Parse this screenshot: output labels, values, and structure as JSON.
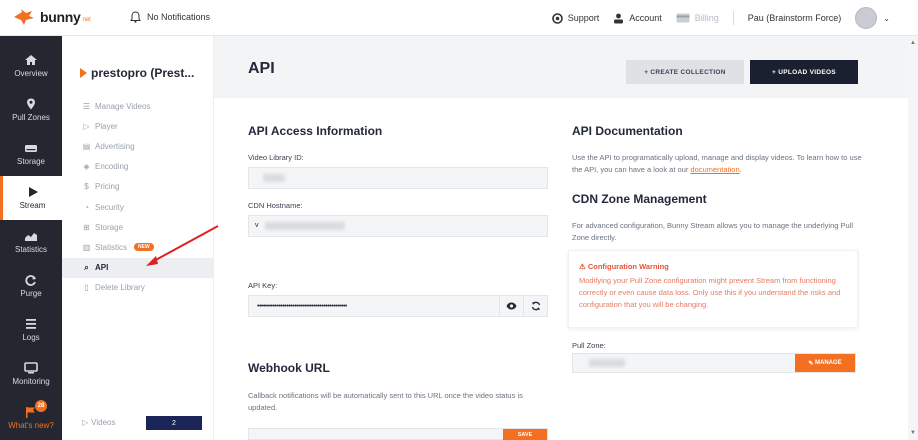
{
  "topbar": {
    "logo_text": "bunny",
    "logo_suffix": "net",
    "notifications": "No Notifications",
    "support": "Support",
    "account": "Account",
    "billing": "Billing",
    "user": "Pau (Brainstorm Force)"
  },
  "nav": {
    "items": [
      {
        "label": "Overview",
        "icon": "home-icon"
      },
      {
        "label": "Pull Zones",
        "icon": "pin-icon"
      },
      {
        "label": "Storage",
        "icon": "drive-icon"
      },
      {
        "label": "Stream",
        "icon": "play-icon"
      },
      {
        "label": "Statistics",
        "icon": "chart-icon"
      },
      {
        "label": "Purge",
        "icon": "refresh-icon"
      },
      {
        "label": "Logs",
        "icon": "list-icon"
      },
      {
        "label": "Monitoring",
        "icon": "monitor-icon"
      },
      {
        "label": "What's new?",
        "icon": "flag-icon"
      }
    ],
    "whatsnew_badge": "28"
  },
  "library": {
    "title": "prestopro (Prest...",
    "menu": [
      {
        "label": "Manage Videos",
        "glyph": "☰"
      },
      {
        "label": "Player",
        "glyph": "▷"
      },
      {
        "label": "Advertising",
        "glyph": "▤"
      },
      {
        "label": "Encoding",
        "glyph": "◈"
      },
      {
        "label": "Pricing",
        "glyph": "$"
      },
      {
        "label": "Security",
        "glyph": "◔"
      },
      {
        "label": "Storage",
        "glyph": "⊞"
      },
      {
        "label": "Statistics",
        "glyph": "▥"
      },
      {
        "label": "API",
        "glyph": "⌕"
      },
      {
        "label": "Delete Library",
        "glyph": "▯"
      }
    ],
    "statistics_badge": "NEW",
    "videos_label": "Videos",
    "videos_count": "2"
  },
  "main": {
    "title": "API",
    "create_collection": "+ CREATE COLLECTION",
    "upload_videos": "+ UPLOAD VIDEOS",
    "access_title": "API Access Information",
    "video_library_id_label": "Video Library ID:",
    "cdn_hostname_label": "CDN Hostname:",
    "cdn_hostname_prefix": "v",
    "api_key_label": "API Key:",
    "api_key_value": "••••••••••••••••••••••••••••••••••••••••••••••",
    "webhook_title": "Webhook URL",
    "webhook_desc": "Callback notifications will be automatically sent to this URL once the video status is updated.",
    "save": "SAVE",
    "docs_title": "API Documentation",
    "docs_desc": "Use the API to programatically upload, manage and display videos. To learn how to use the API, you can have a look at our ",
    "docs_link": "documentation",
    "docs_end": ".",
    "cdn_title": "CDN Zone Management",
    "cdn_desc": "For advanced configuration, Bunny Stream allows you to manage the underlying Pull Zone directly.",
    "warning_title": "Configuration Warning",
    "warning_body": "Modifying your Pull Zone configuration might prevent Stream from functioning correctly or even cause data loss. Only use this if you understand the risks and configuration that you will be changing.",
    "pull_zone_label": "Pull Zone:",
    "manage": "MANAGE"
  },
  "colors": {
    "accent": "#f36f21",
    "nav_bg": "#24272f",
    "dark_button": "#1b2030"
  }
}
